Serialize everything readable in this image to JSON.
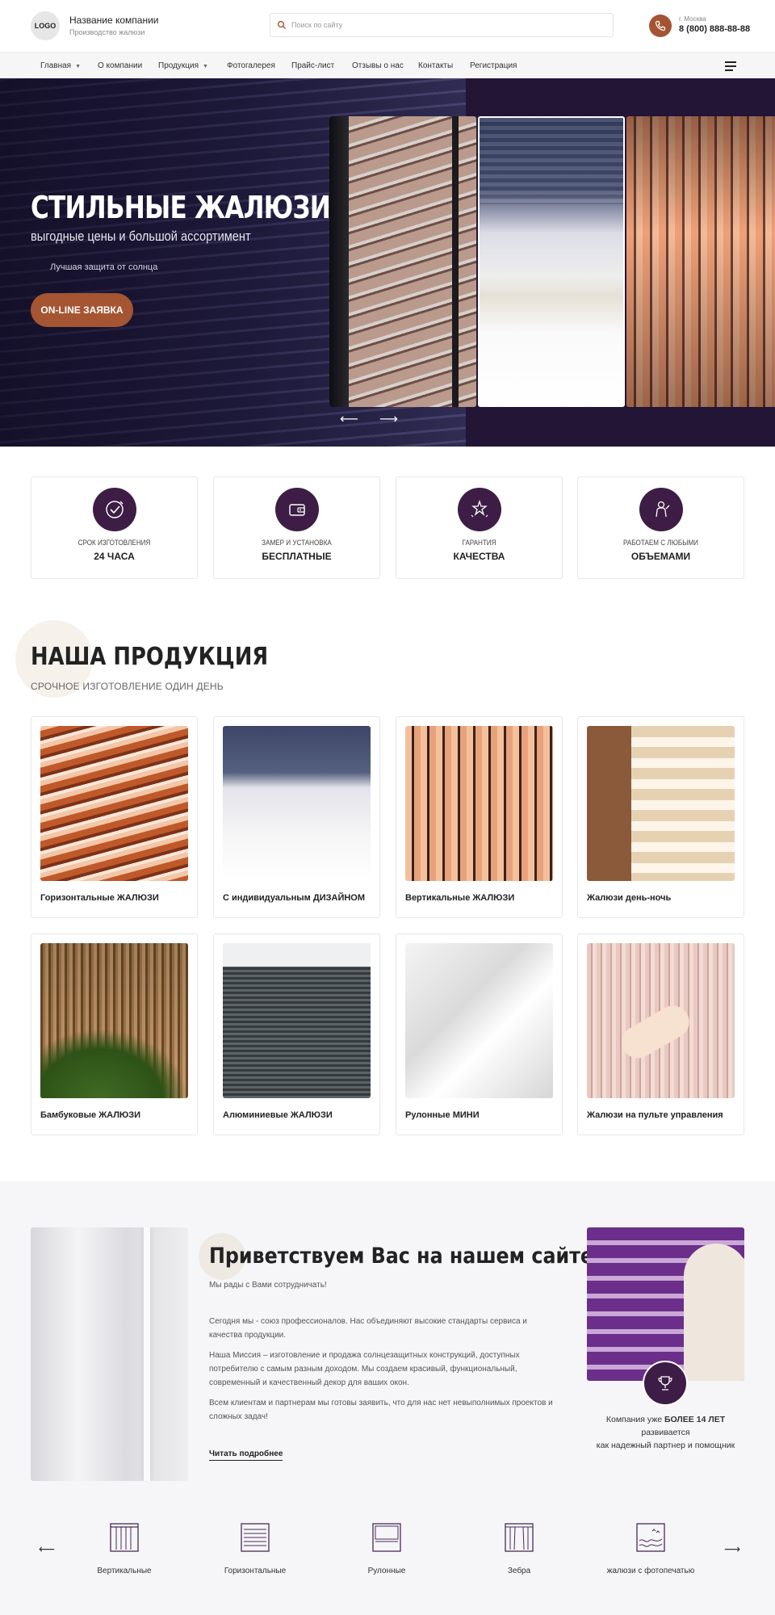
{
  "header": {
    "logo_text": "LOGO",
    "company_name": "Название компании",
    "company_subtitle": "Производство жалюзи",
    "search_placeholder": "Поиск по сайту",
    "city": "г. Москва",
    "phone": "8 (800) 888-88-88"
  },
  "nav": {
    "items": [
      {
        "label": "Главная",
        "has_dropdown": true
      },
      {
        "label": "О компании",
        "has_dropdown": false
      },
      {
        "label": "Продукция",
        "has_dropdown": true
      },
      {
        "label": "Фотогалерея",
        "has_dropdown": false
      },
      {
        "label": "Прайс-лист",
        "has_dropdown": false
      },
      {
        "label": "Отзывы о нас",
        "has_dropdown": false
      },
      {
        "label": "Контакты",
        "has_dropdown": false
      },
      {
        "label": "Регистрация",
        "has_dropdown": false
      }
    ]
  },
  "hero": {
    "title": "СТИЛЬНЫЕ ЖАЛЮЗИ",
    "subtitle": "выгодные цены и большой ассортимент",
    "note": "Лучшая защита от солнца",
    "button": "ON-LINE ЗАЯВКА",
    "prev_arrow": "⟵",
    "next_arrow": "⟶"
  },
  "features": [
    {
      "top": "СРОК ИЗГОТОВЛЕНИЯ",
      "bottom": "24 ЧАСА",
      "icon": "clock-check-icon"
    },
    {
      "top": "ЗАМЕР И УСТАНОВКА",
      "bottom": "БЕСПЛАТНЫЕ",
      "icon": "wallet-icon"
    },
    {
      "top": "ГАРАНТИЯ",
      "bottom": "КАЧЕСТВА",
      "icon": "stars-icon"
    },
    {
      "top": "РАБОТАЕМ С ЛЮБЫМИ",
      "bottom": "ОБЪЕМАМИ",
      "icon": "worker-icon"
    }
  ],
  "products": {
    "title": "НАША ПРОДУКЦИЯ",
    "subtitle": "СРОЧНОЕ ИЗГОТОВЛЕНИЕ ОДИН ДЕНЬ",
    "items": [
      {
        "label": "Горизонтальные ЖАЛЮЗИ"
      },
      {
        "label": "С индивидуальным ДИЗАЙНОМ"
      },
      {
        "label": "Вертикальные ЖАЛЮЗИ"
      },
      {
        "label": "Жалюзи день-ночь"
      },
      {
        "label": "Бамбуковые ЖАЛЮЗИ"
      },
      {
        "label": "Алюминиевые ЖАЛЮЗИ"
      },
      {
        "label": "Рулонные МИНИ"
      },
      {
        "label": "Жалюзи на пульте управления"
      }
    ]
  },
  "welcome": {
    "title": "Приветствуем Вас на нашем сайте",
    "subtitle": "Мы рады с Вами сотрудничать!",
    "paragraphs": [
      "Сегодня мы - союз профессионалов. Нас объединяют высокие стандарты сервиса и качества продукции.",
      "Наша Миссия – изготовление и продажа солнцезащитных конструкций, доступных потребителю с самым разным доходом. Мы создаем красивый, функциональный, современный и качественный декор для ваших окон.",
      "Всем клиентам и партнерам мы готовы заявить, что для нас нет невыполнимых проектов и сложных задач!"
    ],
    "read_more": "Читать подробнее",
    "years_before": "Компания уже",
    "years_bold": "БОЛЕЕ 14 ЛЕТ",
    "years_after": "развивается",
    "years_line2": "как надежный партнер и помощник"
  },
  "categories": {
    "prev_arrow": "⟵",
    "next_arrow": "⟶",
    "items": [
      {
        "label": "Вертикальные",
        "icon": "vertical-blinds-icon"
      },
      {
        "label": "Горизонтальные",
        "icon": "horizontal-blinds-icon"
      },
      {
        "label": "Рулонные",
        "icon": "roller-blinds-icon"
      },
      {
        "label": "Зебра",
        "icon": "zebra-blinds-icon"
      },
      {
        "label": "жалюзи  с фотопечатью",
        "icon": "photo-print-blinds-icon"
      }
    ]
  },
  "colors": {
    "accent": "#a55532",
    "brand_dark": "#3d1d45",
    "hero_bg": "#1a1230"
  }
}
